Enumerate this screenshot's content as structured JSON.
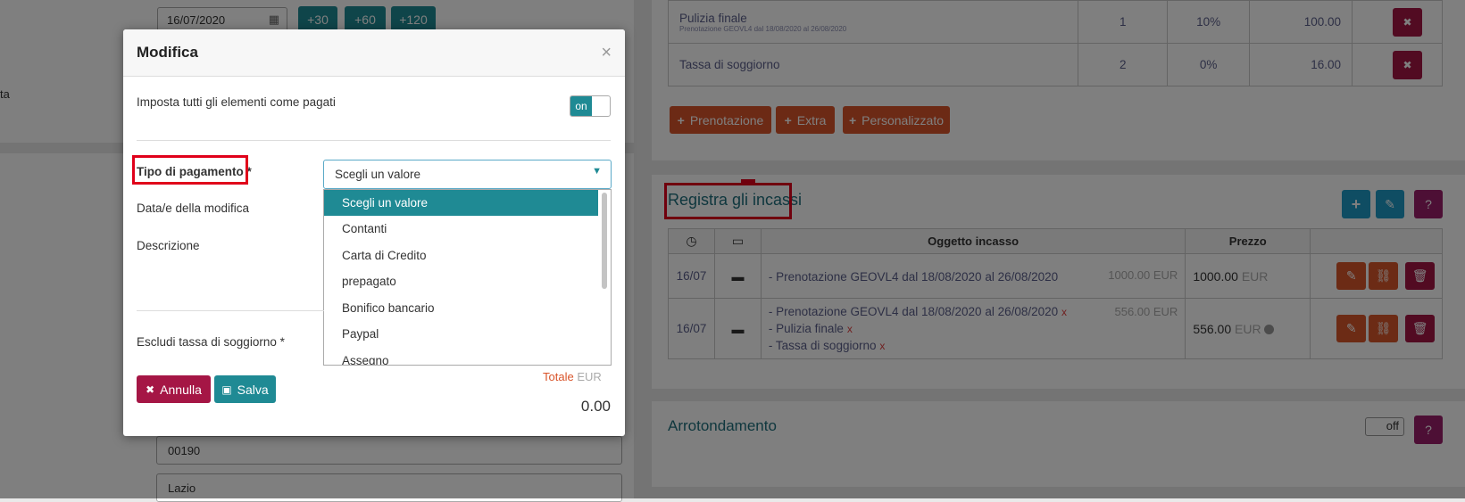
{
  "background_form": {
    "date_value": "16/07/2020",
    "quick_buttons": [
      "+30",
      "+60",
      "+120"
    ],
    "side_text": "ta",
    "postal_code": "00190",
    "region": "Lazio"
  },
  "items_table": {
    "rows": [
      {
        "name": "Pulizia finale",
        "sub": "Prenotazione GEOVL4 dal 18/08/2020 al 26/08/2020",
        "qty": "1",
        "tax": "10%",
        "amount": "100.00"
      },
      {
        "name": "Tassa di soggiorno",
        "sub": "",
        "qty": "2",
        "tax": "0%",
        "amount": "16.00"
      }
    ],
    "add_buttons": [
      "Prenotazione",
      "Extra",
      "Personalizzato"
    ]
  },
  "incassi": {
    "title": "Registra gli incassi",
    "headers": {
      "object": "Oggetto incasso",
      "price": "Prezzo"
    },
    "rows": [
      {
        "date": "16/07",
        "lines": [
          "- Prenotazione GEOVL4 dal 18/08/2020 al 26/08/2020"
        ],
        "line_amount": "1000.00 EUR",
        "price": "1000.00",
        "currency": "EUR",
        "has_x": false
      },
      {
        "date": "16/07",
        "lines": [
          "- Prenotazione GEOVL4 dal 18/08/2020 al 26/08/2020",
          "- Pulizia finale",
          "- Tassa di soggiorno"
        ],
        "line_amount": "556.00 EUR",
        "price": "556.00",
        "currency": "EUR",
        "has_x": true
      }
    ],
    "x_mark": "x"
  },
  "arrotondamento": {
    "title": "Arrotondamento",
    "toggle": "off"
  },
  "help_label": "?",
  "add_label": "+",
  "remove_label": "✖",
  "modal": {
    "title": "Modifica",
    "close": "×",
    "mark_paid_label": "Imposta tutti gli elementi come pagati",
    "mark_paid_toggle": "on",
    "payment_type_label": "Tipo di pagamento *",
    "select_value": "Scegli un valore",
    "options": [
      "Scegli un valore",
      "Contanti",
      "Carta di Credito",
      "prepagato",
      "Bonifico bancario",
      "Paypal",
      "Assegno"
    ],
    "date_label": "Data/e della modifica",
    "description_label": "Descrizione",
    "exclude_tax_label": "Escludi tassa di soggiorno *",
    "total_label": "Totale",
    "total_currency": "EUR",
    "total_value": "0.00",
    "cancel_label": "Annulla",
    "save_label": "Salva"
  }
}
